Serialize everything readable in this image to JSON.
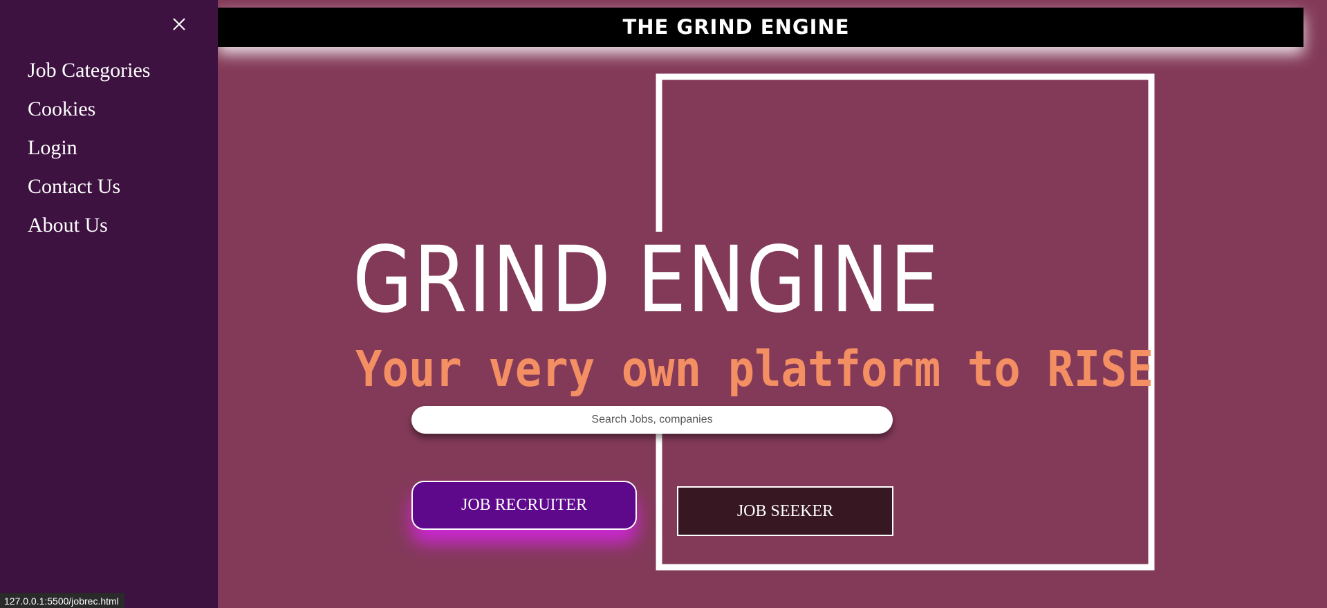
{
  "header": {
    "title": "THE GRIND ENGINE"
  },
  "sidebar": {
    "close_icon": "close-icon",
    "items": [
      {
        "label": "Job Categories"
      },
      {
        "label": "Cookies"
      },
      {
        "label": "Login"
      },
      {
        "label": "Contact Us"
      },
      {
        "label": "About Us"
      }
    ]
  },
  "hero": {
    "title": "GRIND ENGINE",
    "subtitle": "Your very own platform to RISE"
  },
  "search": {
    "placeholder": "Search Jobs, companies",
    "value": ""
  },
  "buttons": {
    "recruiter": "JOB RECRUITER",
    "seeker": "JOB SEEKER"
  },
  "status_bar": {
    "url": "127.0.0.1:5500/jobrec.html"
  },
  "colors": {
    "background": "#833a58",
    "sidebar": "#3d1240",
    "header": "#000000",
    "subtitle": "#f48e63",
    "recruiter_button": "#5e088c",
    "recruiter_glow": "#d624e6",
    "seeker_button": "#371722"
  }
}
